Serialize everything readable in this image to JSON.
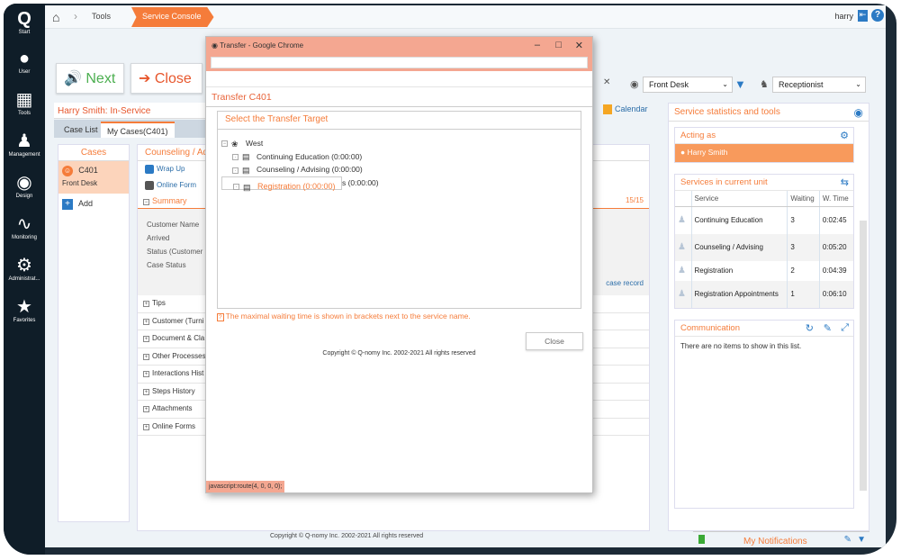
{
  "sidebar": {
    "items": [
      {
        "label": "Start",
        "icon": "q-logo"
      },
      {
        "label": "User",
        "icon": "user-icon"
      },
      {
        "label": "Tools",
        "icon": "calendar-icon"
      },
      {
        "label": "Management",
        "icon": "management-icon"
      },
      {
        "label": "Design",
        "icon": "palette-icon"
      },
      {
        "label": "Monitoring",
        "icon": "pulse-icon"
      },
      {
        "label": "Administrat...",
        "icon": "gears-icon"
      },
      {
        "label": "Favorites",
        "icon": "star-icon"
      }
    ]
  },
  "topbar": {
    "breadcrumb": [
      "Tools",
      "Service Console"
    ],
    "user": "harry"
  },
  "actions": {
    "next": "Next",
    "close": "Close"
  },
  "panel": {
    "title": "Harry Smith: In-Service",
    "tabs": [
      "Case List",
      "My Cases(C401)"
    ]
  },
  "cases": {
    "header": "Cases",
    "items": [
      {
        "id": "C401",
        "location": "Front Desk"
      }
    ],
    "add_label": "Add"
  },
  "detail": {
    "header": "Counseling / Ad",
    "tools": [
      "Wrap Up",
      "Online Form"
    ],
    "summary_label": "Summary",
    "counter": "15/15",
    "fields": [
      "Customer Name",
      "Arrived",
      "Status (Customer",
      "Case Status"
    ],
    "case_record_link": "case record",
    "sections": [
      "Tips",
      "Customer (Turni",
      "Document & Cla",
      "Other Processes",
      "Interactions Hist",
      "Steps History",
      "Attachments",
      "Online Forms"
    ]
  },
  "calendar_label": "Calendar",
  "filters": {
    "location": "Front Desk",
    "role": "Receptionist"
  },
  "right": {
    "title": "Service statistics and tools",
    "acting_as": {
      "label": "Acting as",
      "user": "Harry Smith"
    },
    "services": {
      "label": "Services in current unit",
      "columns": [
        "Service",
        "Waiting",
        "W. Time"
      ],
      "rows": [
        {
          "name": "Continuing Education",
          "waiting": "3",
          "wtime": "0:02:45"
        },
        {
          "name": "Counseling / Advising",
          "waiting": "3",
          "wtime": "0:05:20"
        },
        {
          "name": "Registration",
          "waiting": "2",
          "wtime": "0:04:39"
        },
        {
          "name": "Registration Appointments",
          "waiting": "1",
          "wtime": "0:06:10"
        }
      ]
    },
    "communication": {
      "label": "Communication",
      "empty": "There are no items to show in this list."
    }
  },
  "notifications": {
    "label": "My Notifications"
  },
  "footer": "Copyright © Q-nomy Inc. 2002-2021 All rights reserved",
  "dialog": {
    "window_title": "Transfer - Google Chrome",
    "url": "",
    "heading": "Transfer C401",
    "target_label": "Select the Transfer Target",
    "root": "West",
    "targets": [
      {
        "label": "Continuing Education (0:00:00)",
        "selected": false
      },
      {
        "label": "Counseling / Advising (0:00:00)",
        "selected": false
      },
      {
        "label": "Registration (0:00:00)",
        "selected": true
      },
      {
        "label": "Registration Appointments (0:00:00)",
        "selected": false
      }
    ],
    "hint": "The maximal waiting time is shown in brackets next to the service name.",
    "close_label": "Close",
    "copyright": "Copyright © Q-nomy Inc. 2002-2021 All rights reserved",
    "status_url": "javascript:route(4, 0, 0, 0);"
  },
  "colors": {
    "accent": "#f57c3a",
    "link": "#2b7ac4",
    "sidebar": "#0f1d28",
    "dialog_chrome": "#f4a791"
  }
}
